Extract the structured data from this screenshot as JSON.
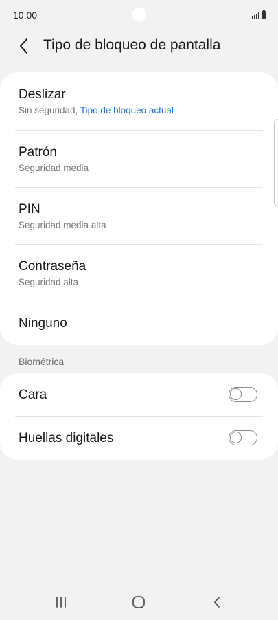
{
  "status_bar": {
    "time": "10:00",
    "icons": [
      "signal-icon",
      "battery-icon"
    ]
  },
  "header": {
    "title": "Tipo de bloqueo de pantalla",
    "back_icon": "chevron-left-icon"
  },
  "lock_options": [
    {
      "title": "Deslizar",
      "subtitle": "Sin seguridad, ",
      "subtitle_accent": "Tipo de bloqueo actual"
    },
    {
      "title": "Patrón",
      "subtitle": "Seguridad media"
    },
    {
      "title": "PIN",
      "subtitle": "Seguridad media alta"
    },
    {
      "title": "Contraseña",
      "subtitle": "Seguridad alta"
    },
    {
      "title": "Ninguno"
    }
  ],
  "biometrics": {
    "section_label": "Biométrica",
    "items": [
      {
        "title": "Cara",
        "enabled": false
      },
      {
        "title": "Huellas digitales",
        "enabled": false
      }
    ]
  },
  "nav_bar": {
    "icons": [
      "recent-apps-icon",
      "home-icon",
      "back-icon"
    ]
  },
  "colors": {
    "accent": "#1a73c8",
    "background": "#f2f2f2",
    "card": "#ffffff"
  }
}
